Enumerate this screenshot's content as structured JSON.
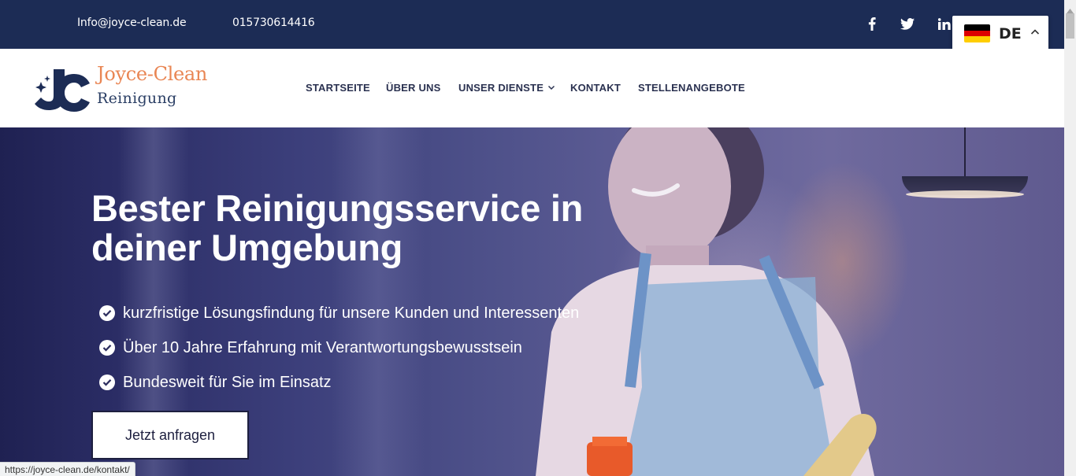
{
  "topbar": {
    "email": "Info@joyce-clean.de",
    "phone": "015730614416",
    "social": [
      "facebook-icon",
      "twitter-icon",
      "linkedin-icon"
    ]
  },
  "language": {
    "code": "DE",
    "flag_colors": [
      "#000000",
      "#dd0000",
      "#ffce00"
    ]
  },
  "logo": {
    "line1": "Joyce-Clean",
    "line2": "Reinigung",
    "accent_color": "#e98654",
    "brand_color": "#1c2c55"
  },
  "nav": {
    "items": [
      {
        "label": "STARTSEITE"
      },
      {
        "label": "ÜBER UNS"
      },
      {
        "label": "UNSER DIENSTE",
        "has_dropdown": true
      },
      {
        "label": "KONTAKT"
      },
      {
        "label": "STELLENANGEBOTE"
      }
    ]
  },
  "hero": {
    "title": "Bester Reinigungsservice in deiner Umgebung",
    "bullets": [
      "kurzfristige Lösungsfindung für unsere Kunden und Interessenten",
      "Über 10 Jahre Erfahrung mit Verantwortungsbewusstsein",
      "Bundesweit für Sie im Einsatz"
    ],
    "cta_label": "Jetzt anfragen"
  },
  "status_url": "https://joyce-clean.de/kontakt/"
}
